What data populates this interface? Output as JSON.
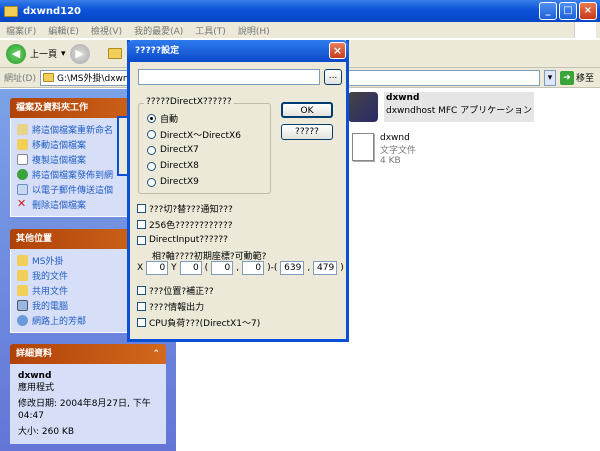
{
  "explorer": {
    "title": "dxwnd120",
    "menu": [
      "檔案(F)",
      "編輯(E)",
      "檢視(V)",
      "我的最愛(A)",
      "工具(T)",
      "說明(H)"
    ],
    "back_label": "上一頁",
    "address_label": "網址(D)",
    "address_value": "G:\\MS外掛\\dxwnd1",
    "go_label": "移至"
  },
  "tasks_panel": {
    "header": "檔案及資料夾工作",
    "items": [
      "將這個檔案重新命名",
      "移動這個檔案",
      "複製這個檔案",
      "將這個檔案發佈到網",
      "以電子郵件傳送這個",
      "刪除這個檔案"
    ]
  },
  "places_panel": {
    "header": "其他位置",
    "items": [
      "MS外掛",
      "我的文件",
      "共用文件",
      "我的電腦",
      "網路上的芳鄰"
    ]
  },
  "details_panel": {
    "header": "詳細資料",
    "name": "dxwnd",
    "type": "應用程式",
    "modified": "修改日期: 2004年8月27日, 下午 04:47",
    "size": "大小: 260 KB",
    "chevron": "⌃"
  },
  "files": [
    {
      "name": "dxwnd",
      "desc": "dxwndhost MFC アプリケーション",
      "icon": "app-icon"
    },
    {
      "name": "dxwnd",
      "desc": "文字文件",
      "size": "4 KB",
      "icon": "text-file-icon"
    }
  ],
  "dialog": {
    "title": "?????設定",
    "browse": "...",
    "ok": "OK",
    "cancel": "?????",
    "group_label": "?????DirectX??????",
    "radios": [
      "自動",
      "DirectX〜DirectX6",
      "DirectX7",
      "DirectX8",
      "DirectX9"
    ],
    "checks": [
      "???切?替???通知???",
      "256色????????????",
      "DirectInput??????"
    ],
    "coords_label": "相?軸????初期座標?可動範?",
    "x_label": "X",
    "y_label": "Y",
    "x_val": "0",
    "y_val": "0",
    "r1": "0",
    "r2": "0",
    "r3": "639",
    "r4": "479",
    "paren_open": "(",
    "comma": ",",
    "range_sep": ")-(",
    "paren_close": ")",
    "checks2": [
      "???位置?補正??",
      "????情報出力",
      "CPU負荷???(DirectX1〜7)"
    ]
  },
  "colors": {
    "xp_blue": "#0a53d8",
    "panel_orange": "#b04208",
    "dialog_bg": "#ece9d8"
  }
}
